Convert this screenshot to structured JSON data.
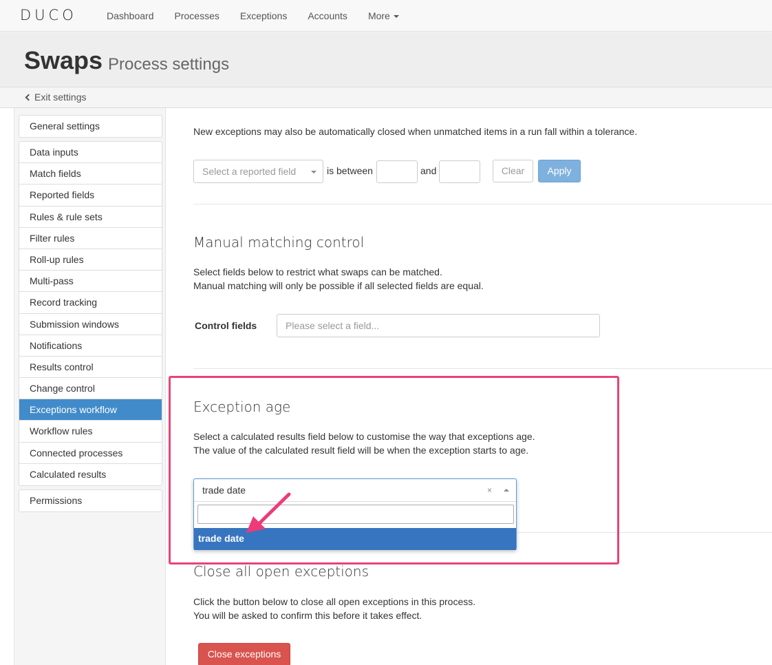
{
  "app": {
    "logo": "DUCO",
    "nav": [
      "Dashboard",
      "Processes",
      "Exceptions",
      "Accounts",
      "More"
    ]
  },
  "header": {
    "title": "Swaps",
    "subtitle": "Process settings",
    "exit_label": "Exit settings"
  },
  "sidebar": {
    "group1": [
      "General settings"
    ],
    "group2": [
      "Data inputs",
      "Match fields",
      "Reported fields",
      "Rules & rule sets",
      "Filter rules",
      "Roll-up rules",
      "Multi-pass",
      "Record tracking",
      "Submission windows",
      "Notifications",
      "Results control",
      "Change control",
      "Exceptions workflow",
      "Workflow rules",
      "Connected processes",
      "Calculated results"
    ],
    "group3": [
      "Permissions"
    ],
    "active": "Exceptions workflow"
  },
  "tolerance": {
    "text": "New exceptions may also be automatically closed when unmatched items in a run fall within a tolerance.",
    "select_placeholder": "Select a reported field",
    "between_label": "is between",
    "and_label": "and",
    "clear_label": "Clear",
    "apply_label": "Apply"
  },
  "manual": {
    "heading": "Manual matching control",
    "line1": "Select fields below to restrict what swaps can be matched.",
    "line2": "Manual matching will only be possible if all selected fields are equal.",
    "control_label": "Control fields",
    "control_placeholder": "Please select a field..."
  },
  "age": {
    "heading": "Exception age",
    "line1": "Select a calculated results field below to customise the way that exceptions age.",
    "line2": "The value of the calculated result field will be when the exception starts to age.",
    "selected": "trade date",
    "clear_symbol": "×",
    "option": "trade date"
  },
  "close": {
    "heading": "Close all open exceptions",
    "line1": "Click the button below to close all open exceptions in this process.",
    "line2": "You will be asked to confirm this before it takes effect.",
    "button": "Close exceptions"
  },
  "colors": {
    "accent": "#428bca",
    "highlight": "#e8437a",
    "danger": "#d9534f"
  }
}
